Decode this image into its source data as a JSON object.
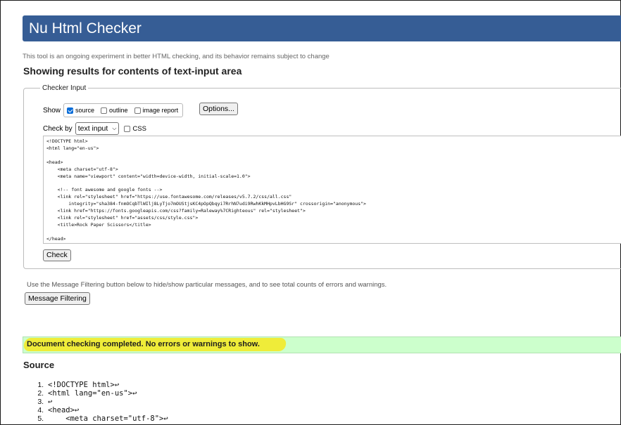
{
  "header": {
    "title": "Nu Html Checker"
  },
  "intro": "This tool is an ongoing experiment in better HTML checking, and its behavior remains subject to change",
  "results_title": "Showing results for contents of text-input area",
  "checker_input": {
    "legend": "Checker Input",
    "show_label": "Show",
    "show_options": [
      {
        "label": "source",
        "checked": true
      },
      {
        "label": "outline",
        "checked": false
      },
      {
        "label": "image report",
        "checked": false
      }
    ],
    "options_button": "Options...",
    "check_by_label": "Check by",
    "check_by_value": "text input",
    "css_label": "CSS",
    "code": "<!DOCTYPE html>\n<html lang=\"en-us\">\n\n<head>\n    <meta charset=\"utf-8\">\n    <meta name=\"viewport\" content=\"width=device-width, initial-scale=1.0\">\n\n    <!-- font awesome and google fonts -->\n    <link rel=\"stylesheet\" href=\"https://use.fontawesome.com/releases/v5.7.2/css/all.css\"\n        integrity=\"sha384-fnmOCqbTlWIlj8LyTjo7mOUStjsKC4pOpQbqyi7RrhN7udi9RwhKkMHpvLbHG9Sr\" crossorigin=\"anonymous\">\n    <link href=\"https://fonts.googleapis.com/css?family=Raleway%7CRighteous\" rel=\"stylesheet\">\n    <link rel=\"stylesheet\" href=\"assets/css/style.css\">\n    <title>Rock Paper Scissors</title>\n\n</head>",
    "check_button": "Check"
  },
  "filter_text": "Use the Message Filtering button below to hide/show particular messages, and to see total counts of errors and warnings.",
  "filter_button": "Message Filtering",
  "success_message": "Document checking completed. No errors or warnings to show.",
  "source": {
    "title": "Source",
    "lines": [
      "<!DOCTYPE html>↩",
      "<html lang=\"en-us\">↩",
      "↩",
      "<head>↩",
      "    <meta charset=\"utf-8\">↩"
    ]
  },
  "colors": {
    "header_bg": "#365d95",
    "success_bg": "#ccffcc",
    "highlight": "#f3ea29",
    "checkbox_on": "#0a6dd8"
  }
}
